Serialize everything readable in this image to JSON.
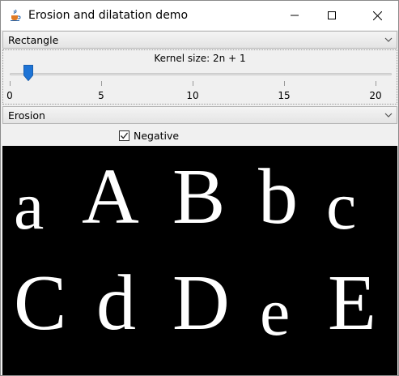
{
  "window": {
    "title": "Erosion and dilatation demo",
    "icons": {
      "app": "java-cup-icon",
      "minimize": "minimize-icon",
      "maximize": "maximize-icon",
      "close": "close-icon"
    }
  },
  "shape_combo": {
    "selected": "Rectangle",
    "icon": "chevron-down-icon"
  },
  "kernel": {
    "label": "Kernel size: 2n + 1",
    "value": 1,
    "min": 0,
    "max": 20,
    "ticks": [
      "0",
      "5",
      "10",
      "15",
      "20"
    ]
  },
  "operation_combo": {
    "selected": "Erosion",
    "icon": "chevron-down-icon"
  },
  "negative": {
    "label": "Negative",
    "checked": true
  },
  "preview": {
    "background": "#000000",
    "foreground": "#ffffff",
    "row1": [
      "a",
      "A",
      "B",
      "b",
      "c"
    ],
    "row2": [
      "C",
      "d",
      "D",
      "e",
      "E"
    ]
  },
  "colors": {
    "thumb": "#1e74d6",
    "titlebar": "#ffffff",
    "panel": "#f0f0f0"
  }
}
